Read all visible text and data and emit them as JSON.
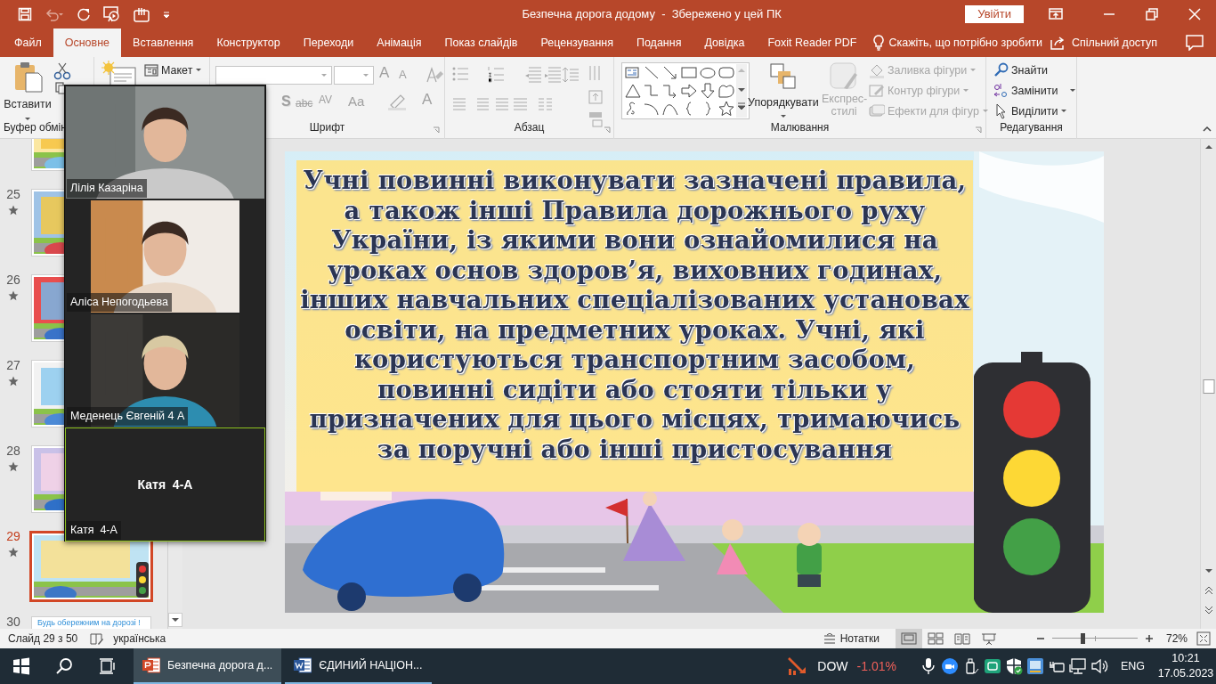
{
  "window": {
    "title": "Безпечна дорога додому  -  Збережено у цей ПК",
    "sign_in": "Увійти"
  },
  "tabs": [
    {
      "label": "Файл",
      "selected": false
    },
    {
      "label": "Основне",
      "selected": true
    },
    {
      "label": "Вставлення",
      "selected": false
    },
    {
      "label": "Конструктор",
      "selected": false
    },
    {
      "label": "Переходи",
      "selected": false
    },
    {
      "label": "Анімація",
      "selected": false
    },
    {
      "label": "Показ слайдів",
      "selected": false
    },
    {
      "label": "Рецензування",
      "selected": false
    },
    {
      "label": "Подання",
      "selected": false
    },
    {
      "label": "Довідка",
      "selected": false
    },
    {
      "label": "Foxit Reader PDF",
      "selected": false
    }
  ],
  "tell_me": "Скажіть, що потрібно зробити",
  "share": "Спільний доступ",
  "ribbon": {
    "paste": "Вставити",
    "clipboard_label": "Буфер обмін",
    "layout": "Макет",
    "font_buttons": [
      {
        "label": "A",
        "kind": "grow"
      },
      {
        "label": "A",
        "kind": "shrink"
      },
      {
        "label": "S",
        "kind": "shadow"
      },
      {
        "label": "abc",
        "kind": "strike"
      },
      {
        "label": "AV",
        "kind": "spacing"
      },
      {
        "label": "Aa",
        "kind": "case"
      },
      {
        "label": "A",
        "kind": "color"
      }
    ],
    "font_label": "Шрифт",
    "paragraph_label": "Абзац",
    "arrange": "Упорядкувати",
    "quick_styles": {
      "label": "Експрес-стилі",
      "disabled": true
    },
    "shape_commands": [
      {
        "label": "Заливка фігури",
        "disabled": true
      },
      {
        "label": "Контур фігури",
        "disabled": true
      },
      {
        "label": "Ефекти для фігур",
        "disabled": true
      }
    ],
    "drawing_label": "Малювання",
    "editing_commands": [
      {
        "label": "Знайти",
        "kind": "find"
      },
      {
        "label": "Замінити",
        "kind": "replace"
      },
      {
        "label": "Виділити",
        "kind": "select"
      }
    ],
    "editing_label": "Редагування"
  },
  "thumbnails": [
    {
      "selected": false
    },
    {
      "number": "25",
      "animated": true,
      "selected": false
    },
    {
      "number": "26",
      "animated": true,
      "selected": false
    },
    {
      "number": "27",
      "animated": true,
      "selected": false
    },
    {
      "number": "28",
      "animated": true,
      "selected": false
    },
    {
      "number": "29",
      "animated": true,
      "selected": true
    },
    {
      "number": "30",
      "animated": false,
      "selected": false,
      "caption": "Будь обережним на дорозі !"
    }
  ],
  "slide": {
    "text": "Учні повинні виконувати зазначені правила, а також інші Правила дорожнього руху України, із якими вони ознайомилися на уроках основ здоров’я, виховних годинах, інших навчальних спеціалізованих установах освіти, на предметних уроках. Учні, які користуються транспортним засобом, повинні сидіти або стояти тільки у призначених для цього місцях, тримаючись за поручні або інші пристосування"
  },
  "video_panel": [
    {
      "name": "Лілія Казаріна",
      "kind": "video",
      "speaking": false
    },
    {
      "name": "Аліса Непогодьева",
      "kind": "video",
      "speaking": false
    },
    {
      "name": "Меденець Євгеній 4 А",
      "kind": "video",
      "speaking": false
    },
    {
      "name": "Катя  4-А",
      "kind": "avatar",
      "display": "Катя  4-А",
      "speaking": true
    }
  ],
  "status_bar": {
    "slide_info": "Слайд 29 з 50",
    "language": "українська",
    "notes": "Нотатки",
    "views": [
      {
        "kind": "normal",
        "selected": true
      },
      {
        "kind": "sorter",
        "selected": false
      },
      {
        "kind": "reading",
        "selected": false
      },
      {
        "kind": "slideshow",
        "selected": false
      }
    ],
    "zoom": {
      "level": 0.35,
      "reading": "72%"
    }
  },
  "taskbar": {
    "apps": [
      {
        "label": "Безпечна дорога д...",
        "kind": "powerpoint",
        "selected": true
      },
      {
        "label": "ЄДИНИЙ НАЦІОН...",
        "kind": "word",
        "selected": false
      }
    ],
    "ticker": {
      "symbol": "DOW",
      "change": "-1.01%"
    },
    "language": "ENG",
    "time": "10:21",
    "date": "17.05.2023"
  }
}
